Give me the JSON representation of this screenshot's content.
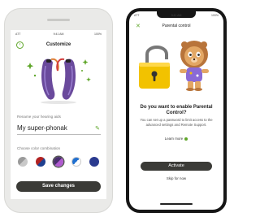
{
  "phone1": {
    "status": {
      "left": "ATT",
      "time": "9:41 AM",
      "right": "100%"
    },
    "back_symbol": "‹",
    "title": "Customize",
    "rename_label": "Rename your hearing aids",
    "device_name": "My super-phonak",
    "color_label": "Choose color combination",
    "save_label": "Save changes",
    "swatches": [
      {
        "a": "#9a9a9a",
        "b": "#c9c9c9",
        "selected": false
      },
      {
        "a": "#b22222",
        "b": "#1f3f8f",
        "selected": false
      },
      {
        "a": "#4a2f6e",
        "b": "#b05ad0",
        "selected": true
      },
      {
        "a": "#1f6fd0",
        "b": "#ffffff",
        "selected": false
      },
      {
        "a": "#2a3a8f",
        "b": "#2a3a8f",
        "selected": false
      }
    ],
    "colors": {
      "accent": "#5fa62a",
      "button": "#3b3b37",
      "aid_purple": "#6a4a9c"
    }
  },
  "phone2": {
    "status": {
      "left": "ATT",
      "time": "9:41 AM",
      "right": "100%"
    },
    "close_symbol": "✕",
    "title": "Parental control",
    "question": "Do you want to enable Parental Control?",
    "body": "You can set up a password to limit access to the advanced settings and Remote Support.",
    "learn_more": "Learn more",
    "activate_label": "Activate",
    "skip_label": "Skip for now",
    "colors": {
      "lock": "#f2c200",
      "accent": "#5fa62a",
      "button": "#3b3b37"
    }
  }
}
